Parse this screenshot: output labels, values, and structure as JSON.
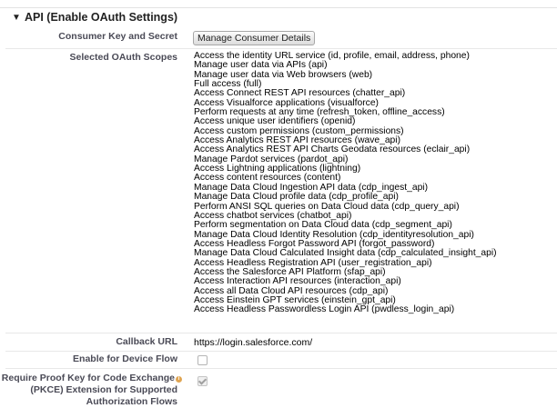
{
  "section": {
    "toggle_icon": "triangle-down-icon",
    "title": "API (Enable OAuth Settings)"
  },
  "consumer": {
    "label": "Consumer Key and Secret",
    "button_label": "Manage Consumer Details"
  },
  "scopes": {
    "label": "Selected OAuth Scopes",
    "items": [
      "Access the identity URL service (id, profile, email, address, phone)",
      "Manage user data via APIs (api)",
      "Manage user data via Web browsers (web)",
      "Full access (full)",
      "Access Connect REST API resources (chatter_api)",
      "Access Visualforce applications (visualforce)",
      "Perform requests at any time (refresh_token, offline_access)",
      "Access unique user identifiers (openid)",
      "Access custom permissions (custom_permissions)",
      "Access Analytics REST API resources (wave_api)",
      "Access Analytics REST API Charts Geodata resources (eclair_api)",
      "Manage Pardot services (pardot_api)",
      "Access Lightning applications (lightning)",
      "Access content resources (content)",
      "Manage Data Cloud Ingestion API data (cdp_ingest_api)",
      "Manage Data Cloud profile data (cdp_profile_api)",
      "Perform ANSI SQL queries on Data Cloud data (cdp_query_api)",
      "Access chatbot services (chatbot_api)",
      "Perform segmentation on Data Cloud data (cdp_segment_api)",
      "Manage Data Cloud Identity Resolution (cdp_identityresolution_api)",
      "Access Headless Forgot Password API (forgot_password)",
      "Manage Data Cloud Calculated Insight data (cdp_calculated_insight_api)",
      "Access Headless Registration API (user_registration_api)",
      "Access the Salesforce API Platform (sfap_api)",
      "Access Interaction API resources (interaction_api)",
      "Access all Data Cloud API resources (cdp_api)",
      "Access Einstein GPT services (einstein_gpt_api)",
      "Access Headless Passwordless Login API (pwdless_login_api)"
    ]
  },
  "callback": {
    "label": "Callback URL",
    "value": "https://login.salesforce.com/"
  },
  "device_flow": {
    "label": "Enable for Device Flow",
    "checked": false
  },
  "pkce": {
    "label_lines": [
      "Require Proof Key for Code Exchange",
      "(PKCE) Extension for Supported",
      "Authorization Flows"
    ],
    "info_icon": "info-icon",
    "checked": true
  }
}
